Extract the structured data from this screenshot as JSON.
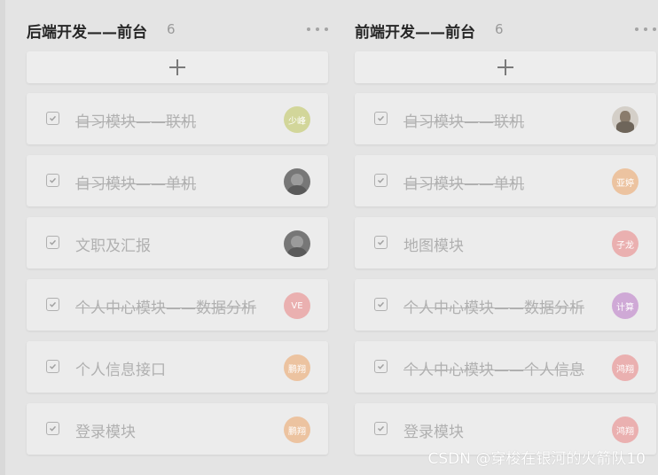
{
  "columns": [
    {
      "title": "后端开发——前台",
      "count": "6",
      "cards": [
        {
          "title": "自习模块——联机",
          "done": true,
          "avatar": {
            "text": "少峰",
            "color": "#d2d69a"
          }
        },
        {
          "title": "自习模块——单机",
          "done": true,
          "avatar": {
            "text": "",
            "color": "#777777",
            "kind": "photo"
          }
        },
        {
          "title": "文职及汇报",
          "done": false,
          "avatar": {
            "text": "",
            "color": "#777777",
            "kind": "photo"
          }
        },
        {
          "title": "个人中心模块——数据分析",
          "done": true,
          "avatar": {
            "text": "VE",
            "color": "#eab0b0"
          }
        },
        {
          "title": "个人信息接口",
          "done": false,
          "avatar": {
            "text": "鹏翔",
            "color": "#ecc3a0"
          }
        },
        {
          "title": "登录模块",
          "done": false,
          "avatar": {
            "text": "鹏翔",
            "color": "#ecc3a0"
          }
        }
      ]
    },
    {
      "title": "前端开发——前台",
      "count": "6",
      "cards": [
        {
          "title": "自习模块——联机",
          "done": true,
          "avatar": {
            "text": "",
            "color": "#d4cfc8",
            "kind": "photo2"
          }
        },
        {
          "title": "自习模块——单机",
          "done": true,
          "avatar": {
            "text": "亚婷",
            "color": "#ecc3a0"
          }
        },
        {
          "title": "地图模块",
          "done": false,
          "avatar": {
            "text": "子龙",
            "color": "#eab0b0"
          }
        },
        {
          "title": "个人中心模块——数据分析",
          "done": true,
          "avatar": {
            "text": "计算",
            "color": "#cfa9d6"
          }
        },
        {
          "title": "个人中心模块——个人信息",
          "done": true,
          "avatar": {
            "text": "鸿翔",
            "color": "#eab0b0"
          }
        },
        {
          "title": "登录模块",
          "done": false,
          "avatar": {
            "text": "鸿翔",
            "color": "#eab0b0"
          }
        }
      ]
    }
  ],
  "watermark": "CSDN @穿梭在银河的火箭队10"
}
